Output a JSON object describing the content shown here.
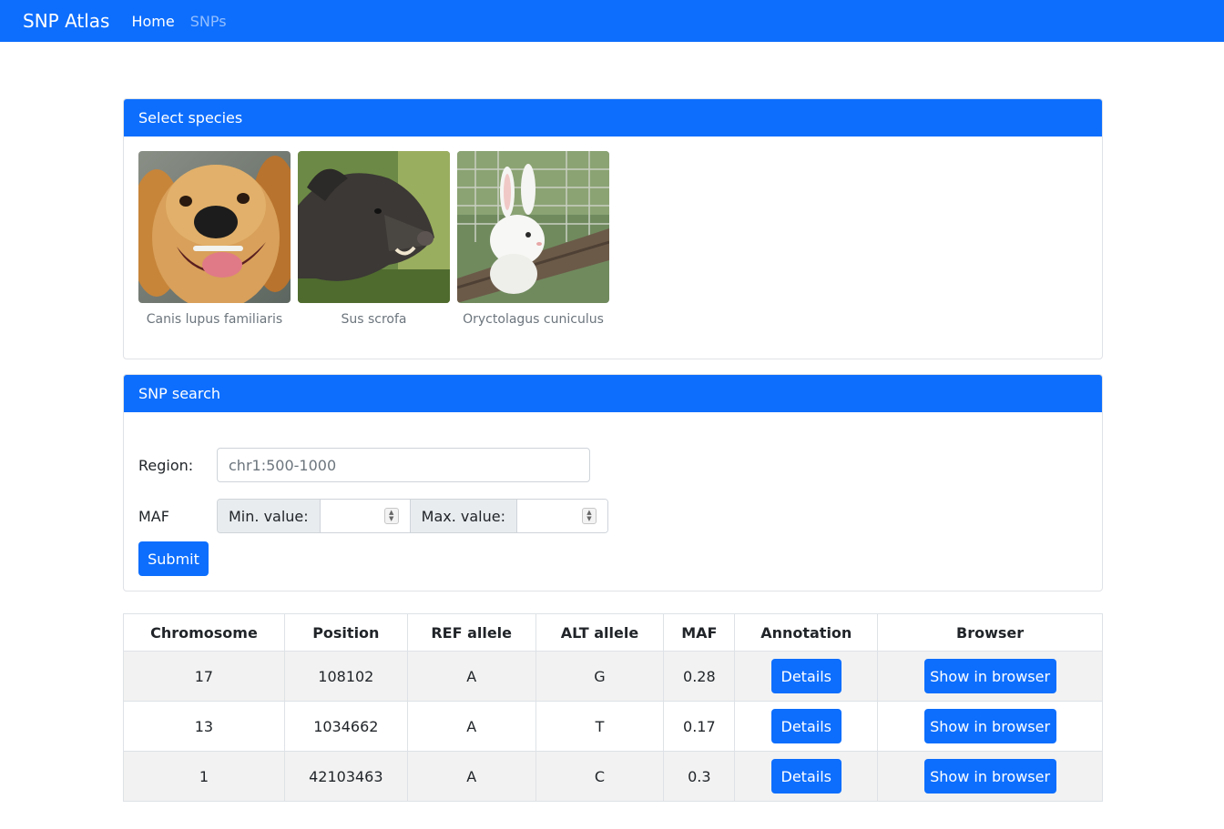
{
  "nav": {
    "brand": "SNP Atlas",
    "links": [
      "Home",
      "SNPs"
    ]
  },
  "species_card": {
    "header": "Select species",
    "species": [
      {
        "name": "Canis lupus familiaris",
        "image": "dog"
      },
      {
        "name": "Sus scrofa",
        "image": "wild-boar"
      },
      {
        "name": "Oryctolagus cuniculus",
        "image": "rabbit"
      }
    ]
  },
  "search_card": {
    "header": "SNP search",
    "region_label": "Region:",
    "region_placeholder": "chr1:500-1000",
    "maf_label": "MAF",
    "min_label": "Min. value:",
    "max_label": "Max. value:",
    "submit_label": "Submit"
  },
  "table": {
    "headers": [
      "Chromosome",
      "Position",
      "REF allele",
      "ALT allele",
      "MAF",
      "Annotation",
      "Browser"
    ],
    "rows": [
      {
        "chromosome": "17",
        "position": "108102",
        "ref": "A",
        "alt": "G",
        "maf": "0.28",
        "details": "Details",
        "browser": "Show in browser"
      },
      {
        "chromosome": "13",
        "position": "1034662",
        "ref": "A",
        "alt": "T",
        "maf": "0.17",
        "details": "Details",
        "browser": "Show in browser"
      },
      {
        "chromosome": "1",
        "position": "42103463",
        "ref": "A",
        "alt": "C",
        "maf": "0.3",
        "details": "Details",
        "browser": "Show in browser"
      }
    ]
  },
  "colors": {
    "primary": "#0d6efd",
    "stripe": "#f2f2f2"
  }
}
